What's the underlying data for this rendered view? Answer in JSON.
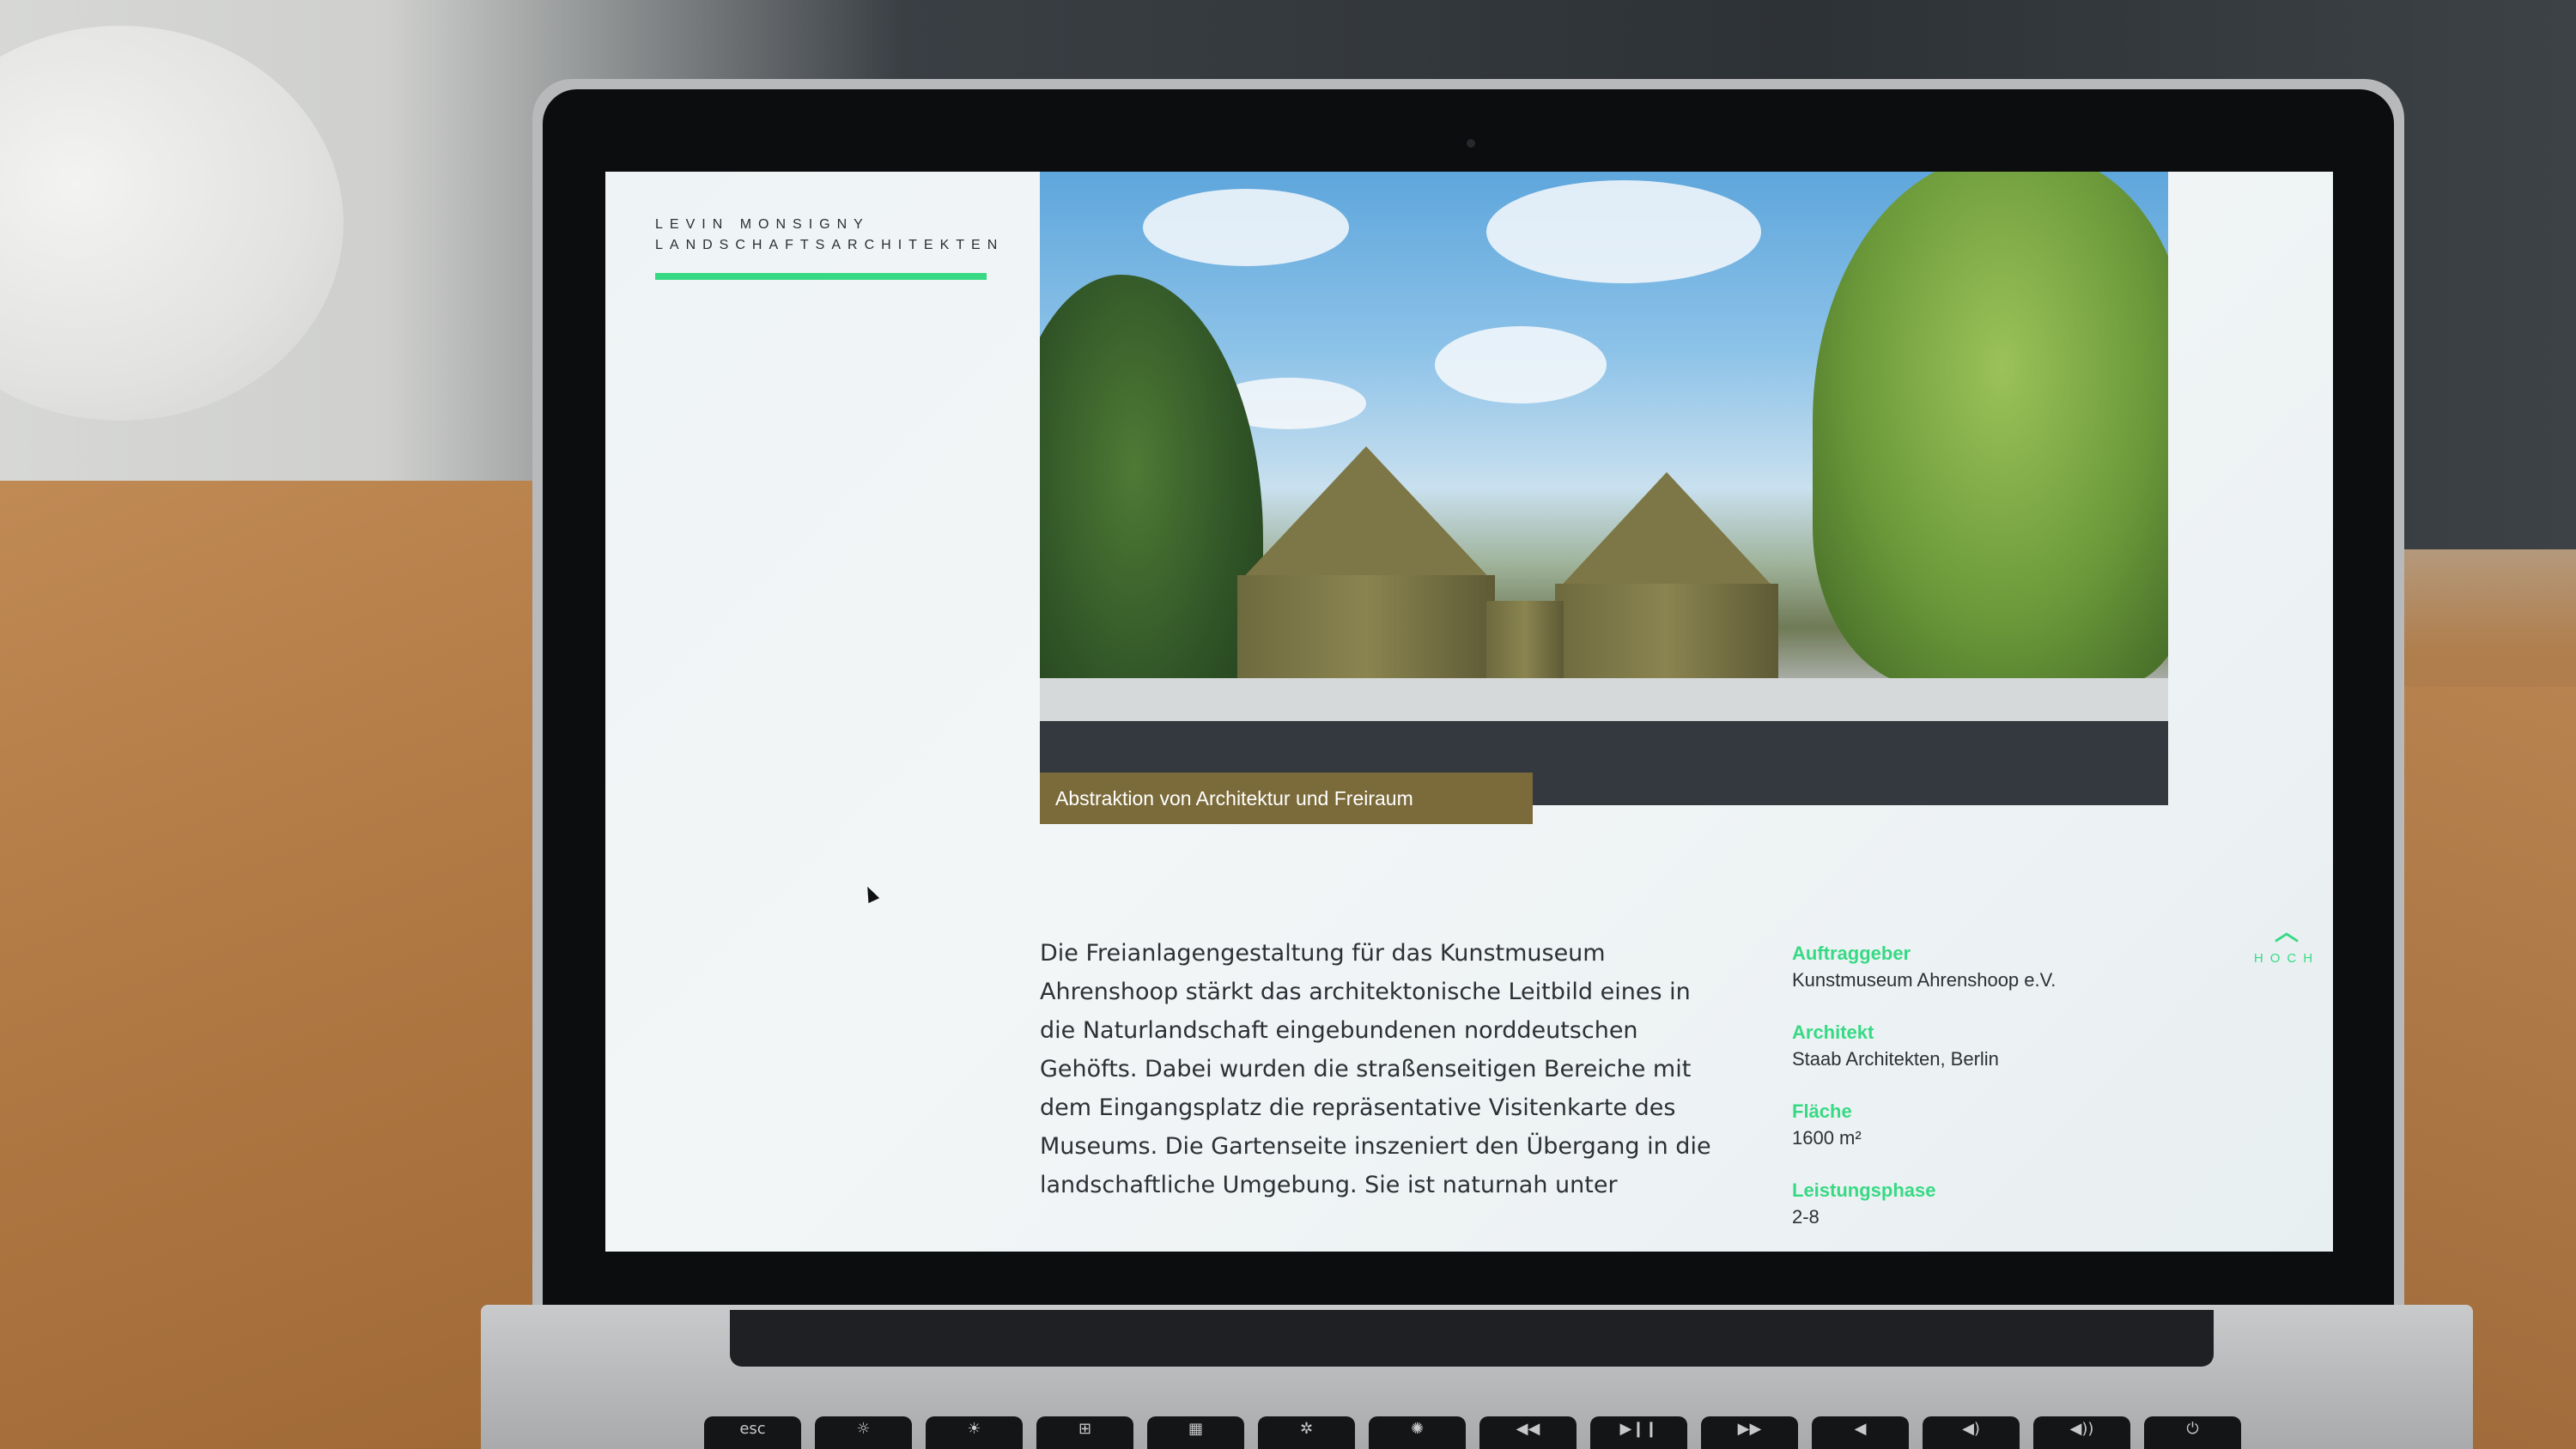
{
  "site": {
    "logo_line1": "LEVIN MONSIGNY",
    "logo_line2": "LANDSCHAFTSARCHITEKTEN",
    "accent_color": "#38d984"
  },
  "hero": {
    "caption": "Abstraktion von Architektur und Freiraum"
  },
  "project": {
    "description": "Die Freianlagengestaltung für das Kunstmuseum Ahrenshoop stärkt das architektonische Leitbild eines in die Naturlandschaft eingebundenen norddeutschen Gehöfts. Dabei wurden die straßenseitigen Bereiche mit dem Eingangsplatz die repräsentative Visitenkarte des Museums. Die Gartenseite inszeniert den Übergang in die landschaftliche Umgebung. Sie ist naturnah unter",
    "details": [
      {
        "label": "Auftraggeber",
        "value": "Kunstmuseum Ahrenshoop e.V."
      },
      {
        "label": "Architekt",
        "value": "Staab Architekten, Berlin"
      },
      {
        "label": "Fläche",
        "value": "1600 m²"
      },
      {
        "label": "Leistungsphase",
        "value": "2-8"
      }
    ]
  },
  "back_to_top": {
    "icon": "chevron-up-icon",
    "label": "HOCH"
  },
  "keyboard": {
    "keys": [
      "esc",
      "☼",
      "☀",
      "⊞",
      "▦",
      "✲",
      "✺",
      "◀◀",
      "▶❙❙",
      "▶▶",
      "◀",
      "◀)",
      "◀))",
      "⏻"
    ]
  }
}
